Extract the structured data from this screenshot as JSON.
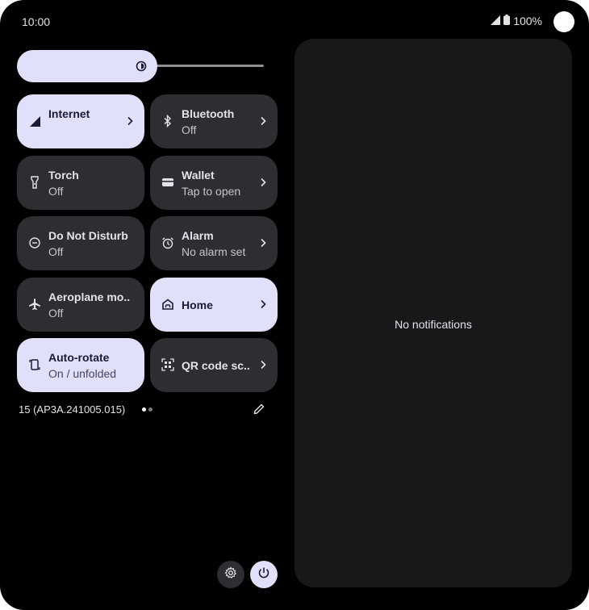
{
  "status": {
    "time": "10:00",
    "battery": "100%"
  },
  "tiles": [
    {
      "id": "internet",
      "title": "Internet",
      "subtitle": "",
      "icon": "signal-icon",
      "active": true,
      "chevron": true
    },
    {
      "id": "bluetooth",
      "title": "Bluetooth",
      "subtitle": "Off",
      "icon": "bluetooth-icon",
      "active": false,
      "chevron": true
    },
    {
      "id": "torch",
      "title": "Torch",
      "subtitle": "Off",
      "icon": "torch-icon",
      "active": false,
      "chevron": false
    },
    {
      "id": "wallet",
      "title": "Wallet",
      "subtitle": "Tap to open",
      "icon": "wallet-icon",
      "active": false,
      "chevron": true
    },
    {
      "id": "dnd",
      "title": "Do Not Disturb",
      "subtitle": "Off",
      "icon": "do-not-disturb-icon",
      "active": false,
      "chevron": false
    },
    {
      "id": "alarm",
      "title": "Alarm",
      "subtitle": "No alarm set",
      "icon": "alarm-icon",
      "active": false,
      "chevron": true
    },
    {
      "id": "aeroplane",
      "title": "Aeroplane mo..",
      "subtitle": "Off",
      "icon": "airplane-icon",
      "active": false,
      "chevron": false
    },
    {
      "id": "home",
      "title": "Home",
      "subtitle": "",
      "icon": "home-icon",
      "active": true,
      "chevron": true
    },
    {
      "id": "autorotate",
      "title": "Auto-rotate",
      "subtitle": "On / unfolded",
      "icon": "auto-rotate-icon",
      "active": true,
      "chevron": false
    },
    {
      "id": "qr",
      "title": "QR code sc..",
      "subtitle": "",
      "icon": "qr-code-icon",
      "active": false,
      "chevron": true
    }
  ],
  "build_number": "15 (AP3A.241005.015)",
  "notifications": {
    "empty_text": "No notifications"
  },
  "colors": {
    "active_tile": "#e1e0fb",
    "inactive_tile": "#2e2d31",
    "panel": "#18181b",
    "background": "#000000"
  }
}
